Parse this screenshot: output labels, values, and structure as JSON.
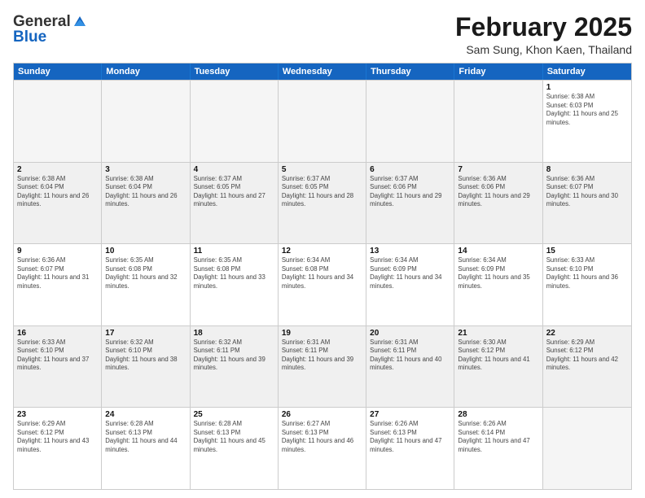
{
  "header": {
    "logo_line1": "General",
    "logo_line2": "Blue",
    "month_year": "February 2025",
    "location": "Sam Sung, Khon Kaen, Thailand"
  },
  "days_of_week": [
    "Sunday",
    "Monday",
    "Tuesday",
    "Wednesday",
    "Thursday",
    "Friday",
    "Saturday"
  ],
  "weeks": [
    [
      {
        "day": "",
        "empty": true
      },
      {
        "day": "",
        "empty": true
      },
      {
        "day": "",
        "empty": true
      },
      {
        "day": "",
        "empty": true
      },
      {
        "day": "",
        "empty": true
      },
      {
        "day": "",
        "empty": true
      },
      {
        "day": "1",
        "sunrise": "6:38 AM",
        "sunset": "6:03 PM",
        "daylight": "11 hours and 25 minutes."
      }
    ],
    [
      {
        "day": "2",
        "sunrise": "6:38 AM",
        "sunset": "6:04 PM",
        "daylight": "11 hours and 26 minutes."
      },
      {
        "day": "3",
        "sunrise": "6:38 AM",
        "sunset": "6:04 PM",
        "daylight": "11 hours and 26 minutes."
      },
      {
        "day": "4",
        "sunrise": "6:37 AM",
        "sunset": "6:05 PM",
        "daylight": "11 hours and 27 minutes."
      },
      {
        "day": "5",
        "sunrise": "6:37 AM",
        "sunset": "6:05 PM",
        "daylight": "11 hours and 28 minutes."
      },
      {
        "day": "6",
        "sunrise": "6:37 AM",
        "sunset": "6:06 PM",
        "daylight": "11 hours and 29 minutes."
      },
      {
        "day": "7",
        "sunrise": "6:36 AM",
        "sunset": "6:06 PM",
        "daylight": "11 hours and 29 minutes."
      },
      {
        "day": "8",
        "sunrise": "6:36 AM",
        "sunset": "6:07 PM",
        "daylight": "11 hours and 30 minutes."
      }
    ],
    [
      {
        "day": "9",
        "sunrise": "6:36 AM",
        "sunset": "6:07 PM",
        "daylight": "11 hours and 31 minutes."
      },
      {
        "day": "10",
        "sunrise": "6:35 AM",
        "sunset": "6:08 PM",
        "daylight": "11 hours and 32 minutes."
      },
      {
        "day": "11",
        "sunrise": "6:35 AM",
        "sunset": "6:08 PM",
        "daylight": "11 hours and 33 minutes."
      },
      {
        "day": "12",
        "sunrise": "6:34 AM",
        "sunset": "6:08 PM",
        "daylight": "11 hours and 34 minutes."
      },
      {
        "day": "13",
        "sunrise": "6:34 AM",
        "sunset": "6:09 PM",
        "daylight": "11 hours and 34 minutes."
      },
      {
        "day": "14",
        "sunrise": "6:34 AM",
        "sunset": "6:09 PM",
        "daylight": "11 hours and 35 minutes."
      },
      {
        "day": "15",
        "sunrise": "6:33 AM",
        "sunset": "6:10 PM",
        "daylight": "11 hours and 36 minutes."
      }
    ],
    [
      {
        "day": "16",
        "sunrise": "6:33 AM",
        "sunset": "6:10 PM",
        "daylight": "11 hours and 37 minutes."
      },
      {
        "day": "17",
        "sunrise": "6:32 AM",
        "sunset": "6:10 PM",
        "daylight": "11 hours and 38 minutes."
      },
      {
        "day": "18",
        "sunrise": "6:32 AM",
        "sunset": "6:11 PM",
        "daylight": "11 hours and 39 minutes."
      },
      {
        "day": "19",
        "sunrise": "6:31 AM",
        "sunset": "6:11 PM",
        "daylight": "11 hours and 39 minutes."
      },
      {
        "day": "20",
        "sunrise": "6:31 AM",
        "sunset": "6:11 PM",
        "daylight": "11 hours and 40 minutes."
      },
      {
        "day": "21",
        "sunrise": "6:30 AM",
        "sunset": "6:12 PM",
        "daylight": "11 hours and 41 minutes."
      },
      {
        "day": "22",
        "sunrise": "6:29 AM",
        "sunset": "6:12 PM",
        "daylight": "11 hours and 42 minutes."
      }
    ],
    [
      {
        "day": "23",
        "sunrise": "6:29 AM",
        "sunset": "6:12 PM",
        "daylight": "11 hours and 43 minutes."
      },
      {
        "day": "24",
        "sunrise": "6:28 AM",
        "sunset": "6:13 PM",
        "daylight": "11 hours and 44 minutes."
      },
      {
        "day": "25",
        "sunrise": "6:28 AM",
        "sunset": "6:13 PM",
        "daylight": "11 hours and 45 minutes."
      },
      {
        "day": "26",
        "sunrise": "6:27 AM",
        "sunset": "6:13 PM",
        "daylight": "11 hours and 46 minutes."
      },
      {
        "day": "27",
        "sunrise": "6:26 AM",
        "sunset": "6:13 PM",
        "daylight": "11 hours and 47 minutes."
      },
      {
        "day": "28",
        "sunrise": "6:26 AM",
        "sunset": "6:14 PM",
        "daylight": "11 hours and 47 minutes."
      },
      {
        "day": "",
        "empty": true
      }
    ]
  ]
}
